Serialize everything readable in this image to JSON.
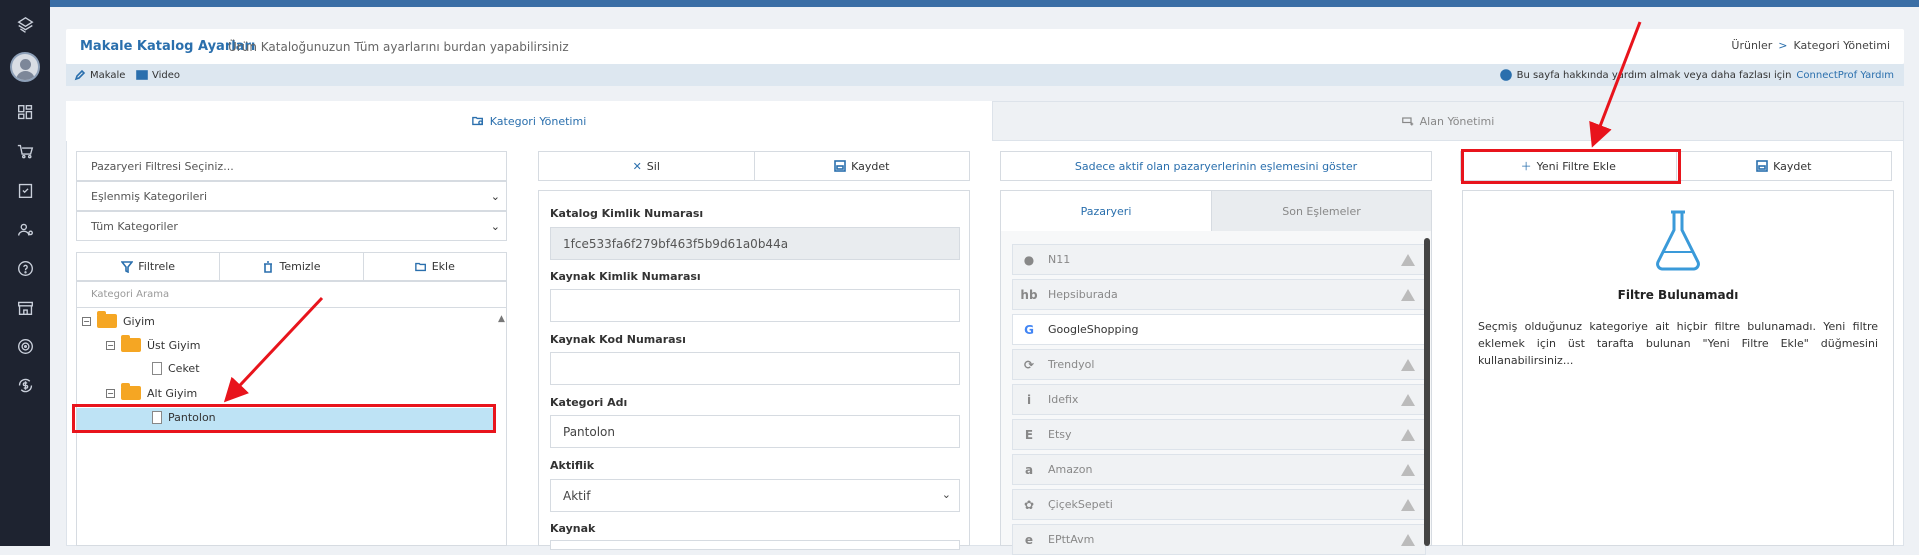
{
  "header": {
    "title": "Makale Katalog Ayarları",
    "subtitle": "Ürün Kataloğunuzun Tüm ayarlarını burdan yapabilirsiniz",
    "breadcrumb": [
      "Ürünler",
      "Kategori Yönetimi"
    ]
  },
  "subbar": {
    "makale": "Makale",
    "video": "Video",
    "help_text": "Bu sayfa hakkında yardım almak veya daha fazlası için",
    "help_link": "ConnectProf Yardım"
  },
  "tabs": {
    "active": "Kategori Yönetimi",
    "inactive": "Alan Yönetimi"
  },
  "left": {
    "filter_placeholder": "Pazaryeri Filtresi Seçiniz...",
    "select1": "Eşlenmiş Kategorileri",
    "select2": "Tüm Kategoriler",
    "btn_filter": "Filtrele",
    "btn_clear": "Temizle",
    "btn_add": "Ekle",
    "search_placeholder": "Kategori Arama",
    "tree": [
      "Giyim",
      "Üst Giyim",
      "Ceket",
      "Alt Giyim",
      "Pantolon"
    ]
  },
  "mid": {
    "btn_delete": "Sil",
    "btn_save": "Kaydet",
    "katalog_label": "Katalog Kimlik Numarası",
    "katalog_value": "1fce533fa6f279bf463f5b9d61a0b44a",
    "kaynak_kimlik_label": "Kaynak Kimlik Numarası",
    "kaynak_kod_label": "Kaynak Kod Numarası",
    "kategori_adi_label": "Kategori Adı",
    "kategori_adi_value": "Pantolon",
    "aktiflik_label": "Aktiflik",
    "aktiflik_value": "Aktif",
    "kaynak_label": "Kaynak"
  },
  "market": {
    "only_active": "Sadece aktif olan pazaryerlerinin eşlemesini göster",
    "tab_market": "Pazaryeri",
    "tab_recent": "Son Eşlemeler",
    "items": [
      "N11",
      "Hepsiburada",
      "GoogleShopping",
      "Trendyol",
      "Idefix",
      "Etsy",
      "Amazon",
      "ÇiçekSepeti",
      "EPttAvm"
    ]
  },
  "filters": {
    "btn_new": "Yeni Filtre Ekle",
    "btn_save": "Kaydet",
    "empty_title": "Filtre Bulunamadı",
    "empty_text": "Seçmiş olduğunuz kategoriye ait hiçbir filtre bulunamadı. Yeni filtre eklemek için üst tarafta bulunan \"Yeni Filtre Ekle\" düğmesini kullanabilirsiniz..."
  },
  "colors": {
    "accent": "#2a6fad",
    "annotation": "#e8141c",
    "selected_row": "#bee3f5",
    "sidebar": "#1e2330"
  }
}
